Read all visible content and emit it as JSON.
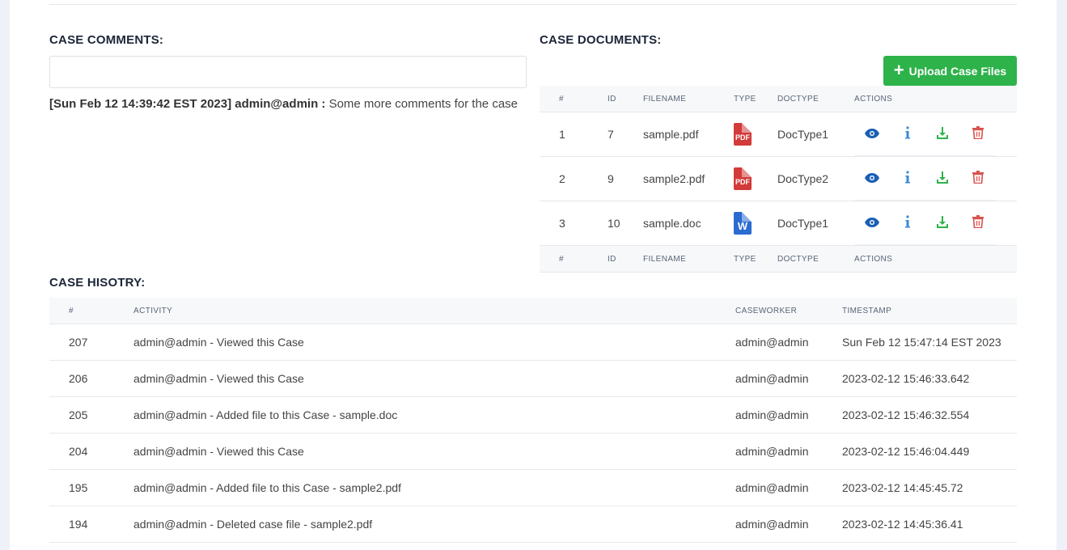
{
  "comments": {
    "title": "CASE COMMENTS:",
    "input_value": "",
    "entries": [
      {
        "meta": "[Sun Feb 12 14:39:42 EST 2023] admin@admin :",
        "text": "Some more comments for the case"
      }
    ]
  },
  "documents": {
    "title": "CASE DOCUMENTS:",
    "upload_label": "Upload Case Files",
    "headers": [
      "#",
      "ID",
      "FILENAME",
      "TYPE",
      "DOCTYPE",
      "ACTIONS"
    ],
    "rows": [
      {
        "num": "1",
        "id": "7",
        "filename": "sample.pdf",
        "type": "pdf",
        "type_glyph": "PDF",
        "doctype": "DocType1"
      },
      {
        "num": "2",
        "id": "9",
        "filename": "sample2.pdf",
        "type": "pdf",
        "type_glyph": "PDF",
        "doctype": "DocType2"
      },
      {
        "num": "3",
        "id": "10",
        "filename": "sample.doc",
        "type": "doc",
        "type_glyph": "W",
        "doctype": "DocType1"
      }
    ],
    "action_icons": [
      "eye-icon",
      "info-icon",
      "download-icon",
      "trash-icon"
    ]
  },
  "history": {
    "title": "CASE HISOTRY:",
    "headers": [
      "#",
      "ACTIVITY",
      "CASEWORKER",
      "TIMESTAMP"
    ],
    "rows": [
      {
        "num": "207",
        "activity": "admin@admin - Viewed this Case",
        "caseworker": "admin@admin",
        "timestamp": "Sun Feb 12 15:47:14 EST 2023"
      },
      {
        "num": "206",
        "activity": "admin@admin - Viewed this Case",
        "caseworker": "admin@admin",
        "timestamp": "2023-02-12 15:46:33.642"
      },
      {
        "num": "205",
        "activity": "admin@admin - Added file to this Case - sample.doc",
        "caseworker": "admin@admin",
        "timestamp": "2023-02-12 15:46:32.554"
      },
      {
        "num": "204",
        "activity": "admin@admin - Viewed this Case",
        "caseworker": "admin@admin",
        "timestamp": "2023-02-12 15:46:04.449"
      },
      {
        "num": "195",
        "activity": "admin@admin - Added file to this Case - sample2.pdf",
        "caseworker": "admin@admin",
        "timestamp": "2023-02-12 14:45:45.72"
      },
      {
        "num": "194",
        "activity": "admin@admin - Deleted case file - sample2.pdf",
        "caseworker": "admin@admin",
        "timestamp": "2023-02-12 14:45:36.41"
      }
    ]
  },
  "colors": {
    "accent_green": "#2eb24a",
    "view_blue": "#1a5fb4",
    "info_blue": "#3a8ad6",
    "download_green": "#2eb24a",
    "delete_red": "#d9534f"
  }
}
